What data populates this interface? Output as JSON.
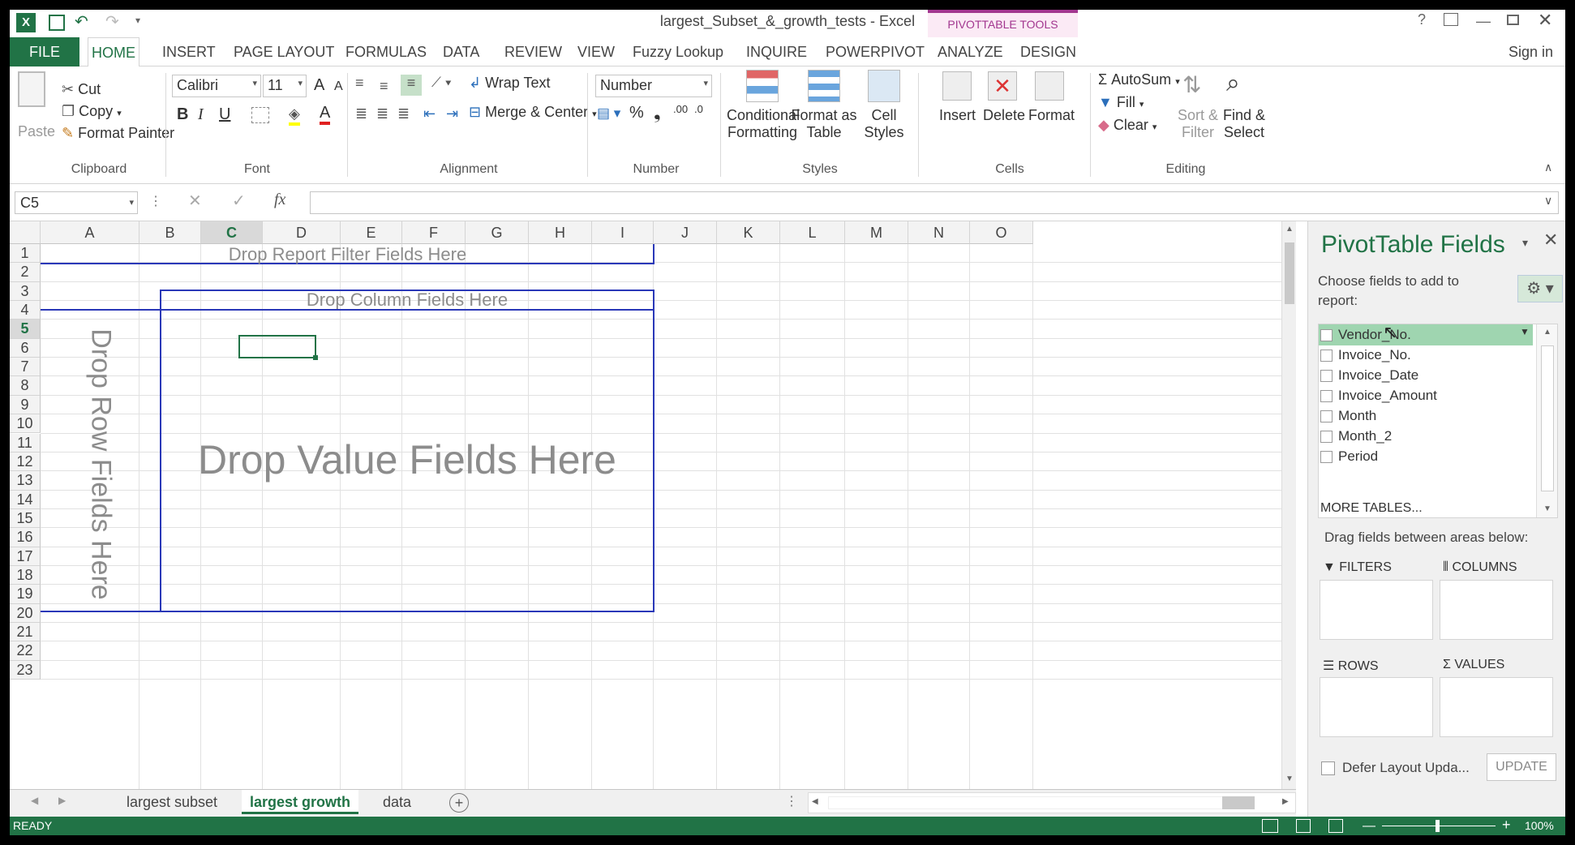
{
  "window": {
    "title": "largest_Subset_&_growth_tests - Excel",
    "context_tab": "PIVOTTABLE TOOLS",
    "sign_in": "Sign in"
  },
  "tabs": [
    "FILE",
    "HOME",
    "INSERT",
    "PAGE LAYOUT",
    "FORMULAS",
    "DATA",
    "REVIEW",
    "VIEW",
    "Fuzzy Lookup",
    "INQUIRE",
    "POWERPIVOT",
    "ANALYZE",
    "DESIGN"
  ],
  "ribbon": {
    "clipboard": {
      "paste": "Paste",
      "cut": "Cut",
      "copy": "Copy",
      "format_painter": "Format Painter",
      "label": "Clipboard"
    },
    "font": {
      "name": "Calibri",
      "size": "11",
      "bold": "B",
      "italic": "I",
      "underline": "U",
      "grow": "A",
      "shrink": "A",
      "color_a": "A",
      "label": "Font"
    },
    "alignment": {
      "wrap": "Wrap Text",
      "merge": "Merge & Center",
      "label": "Alignment"
    },
    "number": {
      "format": "Number",
      "percent": "%",
      "comma": "❟",
      "inc": ".00",
      "dec": ".0",
      "label": "Number"
    },
    "styles": {
      "cond1": "Conditional",
      "cond2": "Formatting",
      "fmt1": "Format as",
      "fmt2": "Table",
      "cell1": "Cell",
      "cell2": "Styles",
      "label": "Styles"
    },
    "cells": {
      "insert": "Insert",
      "delete": "Delete",
      "format": "Format",
      "label": "Cells"
    },
    "editing": {
      "autosum": "AutoSum",
      "fill": "Fill",
      "clear": "Clear",
      "sort1": "Sort &",
      "sort2": "Filter",
      "find1": "Find &",
      "find2": "Select",
      "label": "Editing"
    }
  },
  "formula_bar": {
    "name_box": "C5",
    "fx": "fx",
    "value": ""
  },
  "columns": [
    "A",
    "B",
    "C",
    "D",
    "E",
    "F",
    "G",
    "H",
    "I",
    "J",
    "K",
    "L",
    "M",
    "N",
    "O"
  ],
  "rows": [
    "1",
    "2",
    "3",
    "4",
    "5",
    "6",
    "7",
    "8",
    "9",
    "10",
    "11",
    "12",
    "13",
    "14",
    "15",
    "16",
    "17",
    "18",
    "19",
    "20",
    "21",
    "22",
    "23"
  ],
  "pivot": {
    "report_filter": "Drop Report Filter Fields Here",
    "column_fields": "Drop Column Fields Here",
    "row_fields": "Drop Row Fields Here",
    "value_fields": "Drop Value Fields Here"
  },
  "sheets": [
    "largest subset",
    "largest growth",
    "data"
  ],
  "status": {
    "ready": "READY",
    "zoom": "100%"
  },
  "pane": {
    "title": "PivotTable Fields",
    "choose1": "Choose fields to add to",
    "choose2": "report:",
    "fields": [
      "Vendor_No.",
      "Invoice_No.",
      "Invoice_Date",
      "Invoice_Amount",
      "Month",
      "Month_2",
      "Period"
    ],
    "more_tables": "MORE TABLES...",
    "drag_hint": "Drag fields between areas below:",
    "filters": "FILTERS",
    "columns": "COLUMNS",
    "rows": "ROWS",
    "values": "VALUES",
    "defer": "Defer Layout Upda...",
    "update": "UPDATE"
  },
  "colors": {
    "excel_green": "#217346",
    "pivot_border": "#2a38b8",
    "context": "#a2378f",
    "field_highlight": "#9fd5b0"
  }
}
